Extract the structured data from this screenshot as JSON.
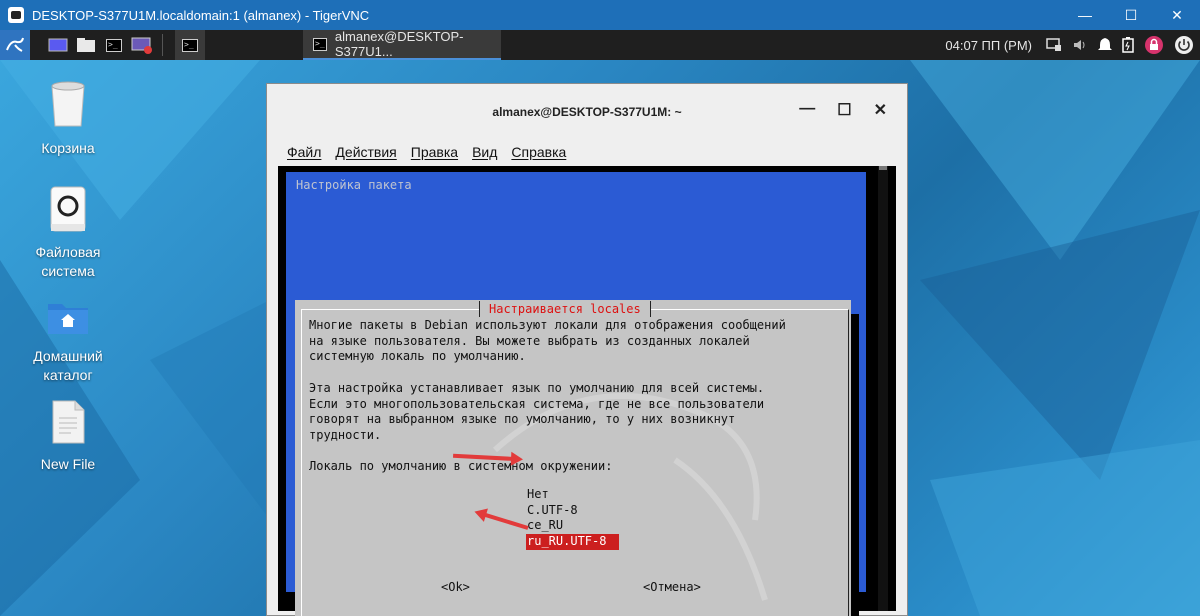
{
  "vnc_window": {
    "title": "DESKTOP-S377U1M.localdomain:1 (almanex) - TigerVNC",
    "controls": {
      "minimize": "—",
      "maximize": "☐",
      "close": "✕"
    }
  },
  "panel": {
    "task_label": "almanex@DESKTOP-S377U1...",
    "clock": "04:07 ПП (PM)"
  },
  "desktop": {
    "icons": [
      {
        "label": "Корзина",
        "icon": "trash-icon"
      },
      {
        "label": "Файловая система",
        "icon": "drive-icon"
      },
      {
        "label": "Домашний каталог",
        "icon": "home-folder-icon"
      },
      {
        "label": "New File",
        "icon": "file-icon"
      }
    ]
  },
  "terminal": {
    "title": "almanex@DESKTOP-S377U1M: ~",
    "controls": {
      "minimize": "—",
      "maximize": "☐",
      "close": "✕"
    },
    "menu": [
      "Файл",
      "Действия",
      "Правка",
      "Вид",
      "Справка"
    ]
  },
  "debconf": {
    "package_title": "Настройка пакета",
    "dialog_caption": "Настраивается locales",
    "text": "Многие пакеты в Debian используют локали для отображения сообщений\nна языке пользователя. Вы можете выбрать из созданных локалей\nсистемную локаль по умолчанию.\n\nЭта настройка устанавливает язык по умолчанию для всей системы.\nЕсли это многопользовательская система, где не все пользователи\nговорят на выбранном языке по умолчанию, то у них возникнут\nтрудности.\n\nЛокаль по умолчанию в системном окружении:",
    "options": [
      "Нет",
      "C.UTF-8",
      "ce_RU",
      "ru_RU.UTF-8"
    ],
    "selected_option": "ru_RU.UTF-8",
    "ok_label": "<Ok>",
    "cancel_label": "<Отмена>"
  },
  "colors": {
    "dialog_bg": "#c5c5c5",
    "terminal_blue": "#2b5bd4",
    "selection_red": "#cc1f1f",
    "annotation_arrow": "#e23b3b"
  }
}
